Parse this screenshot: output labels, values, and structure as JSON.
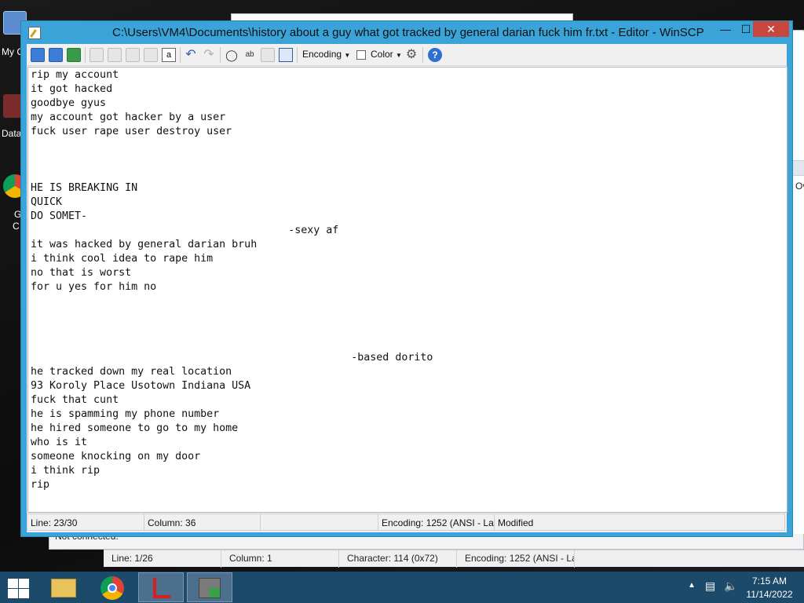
{
  "desktop": {
    "icons": [
      {
        "label": "My C"
      },
      {
        "label": "Data"
      },
      {
        "label": "G"
      },
      {
        "label": "C"
      }
    ]
  },
  "background_window": {
    "right_fragment": "Ov",
    "not_connected": "Not connected.",
    "status": {
      "line": "Line: 1/26",
      "column": "Column: 1",
      "character": "Character: 114 (0x72)",
      "encoding": "Encoding: 1252  (ANSI - La"
    }
  },
  "editor": {
    "title": "C:\\Users\\VM4\\Documents\\history about a guy what got tracked by general darian fuck him fr.txt - Editor - WinSCP",
    "controls": {
      "minimize": "—",
      "maximize": "☐",
      "close": "✕"
    },
    "toolbar": {
      "encoding_label": "Encoding",
      "color_label": "Color",
      "help_label": "?"
    },
    "lines": [
      "rip my account",
      "it got hacked",
      "goodbye gyus",
      "my account got hacker by a user",
      "fuck user rape user destroy user",
      "",
      "",
      "",
      "HE IS BREAKING IN",
      "QUICK",
      "DO SOMET-",
      "                                         -sexy af",
      "it was hacked by general darian bruh",
      "i think cool idea to rape him",
      "no that is worst",
      "for u yes for him no",
      "",
      "",
      "",
      "",
      "                                                   -based dorito",
      "he tracked down my real location",
      "93 Koroly Place Usotown Indiana USA",
      "fuck that cunt",
      "he is spamming my phone number",
      "he hired someone to go to my home",
      "who is it",
      "someone knocking on my door",
      "i think rip",
      "rip"
    ],
    "status": {
      "line": "Line: 23/30",
      "column": "Column: 36",
      "blank": "",
      "encoding": "Encoding: 1252  (ANSI - La",
      "modified": "Modified"
    }
  },
  "taskbar": {
    "time": "7:15 AM",
    "date": "11/14/2022",
    "apps": [
      {
        "name": "file-explorer"
      },
      {
        "name": "chrome"
      },
      {
        "name": "pdf-app"
      },
      {
        "name": "winscp"
      }
    ]
  },
  "colors": {
    "title_accent": "#3aa4d8",
    "close_red": "#c7463d",
    "taskbar": "#1b4a6b"
  }
}
